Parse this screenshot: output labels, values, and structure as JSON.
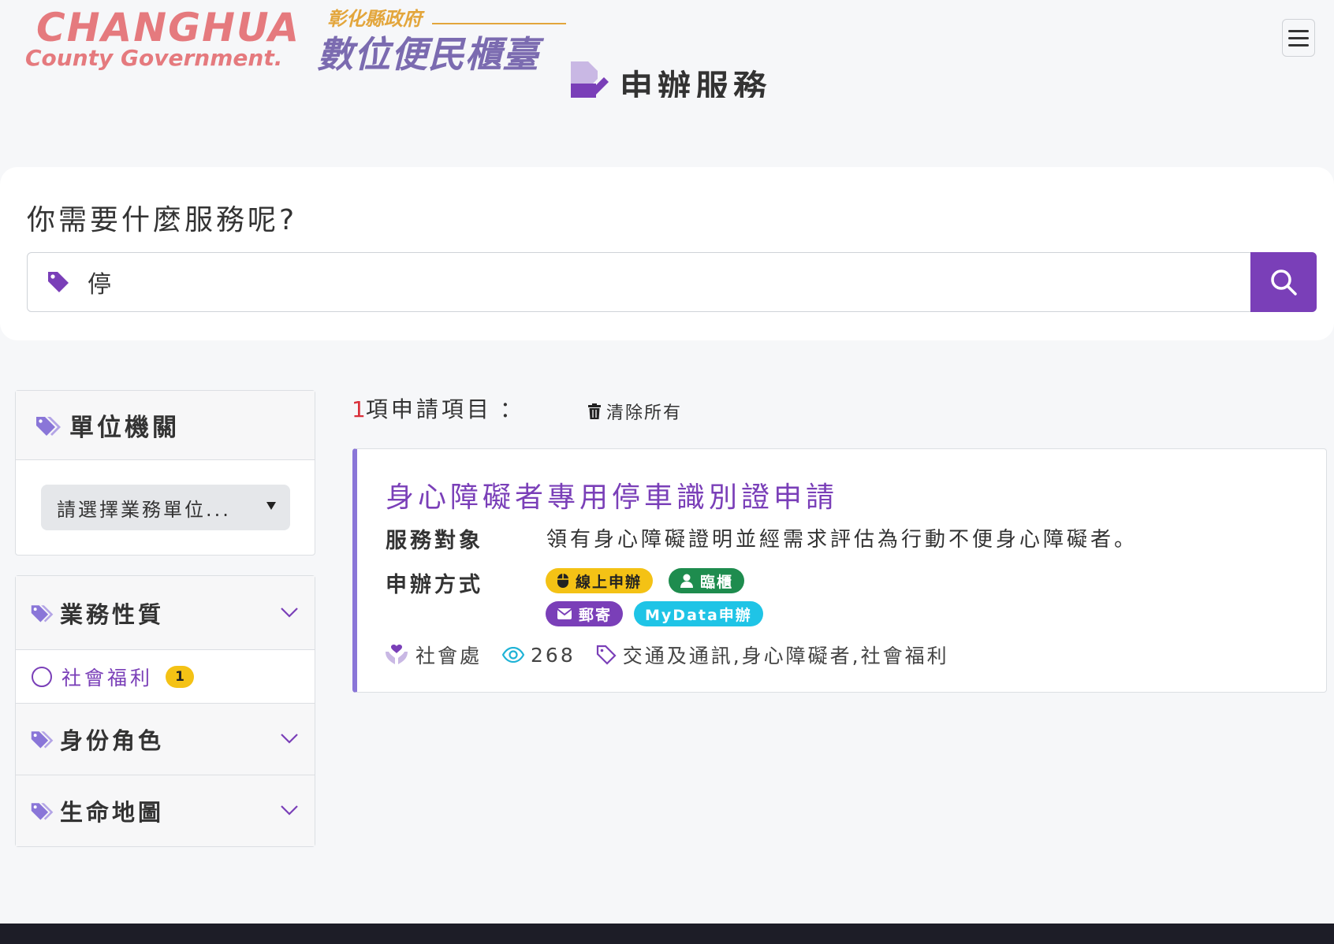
{
  "header": {
    "logo_en_line1": "CHANGHUA",
    "logo_en_line2": "County Government.",
    "logo_zh_line1": "彰化縣政府",
    "logo_zh_line2": "數位便民櫃臺",
    "page_title": "申辦服務",
    "menu_icon": "hamburger-icon"
  },
  "search": {
    "heading": "你需要什麼服務呢?",
    "value": "停",
    "tag_icon": "tag-icon",
    "button_icon": "search-icon"
  },
  "sidebar": {
    "unit": {
      "heading": "單位機關",
      "select_value": "請選擇業務單位..."
    },
    "sections": [
      {
        "heading": "業務性質",
        "expanded": true,
        "items": [
          {
            "label": "社會福利",
            "count": "1"
          }
        ]
      },
      {
        "heading": "身份角色",
        "expanded": false
      },
      {
        "heading": "生命地圖",
        "expanded": false
      }
    ]
  },
  "results": {
    "count": "1",
    "count_label": "項申請項目",
    "colon": "：",
    "clear_label": "清除所有",
    "items": [
      {
        "title": "身心障礙者專用停車識別證申請",
        "target_label": "服務對象",
        "target_value": "領有身心障礙證明並經需求評估為行動不便身心障礙者。",
        "method_label": "申辦方式",
        "methods": [
          "線上申辦",
          "臨櫃",
          "郵寄",
          "MyData申辦"
        ],
        "department": "社會處",
        "views": "268",
        "tags": "交通及通訊,身心障礙者,社會福利"
      }
    ]
  },
  "colors": {
    "accent": "#7a3fb8",
    "logo_red": "#e57a7e",
    "logo_gold": "#e3a63c",
    "logo_purple": "#7b6bb0",
    "badge_yellow": "#f4c215",
    "badge_green": "#1e8c4e",
    "badge_cyan": "#1fc4e6",
    "count_red": "#d9303a",
    "footer": "#1d1d27"
  }
}
